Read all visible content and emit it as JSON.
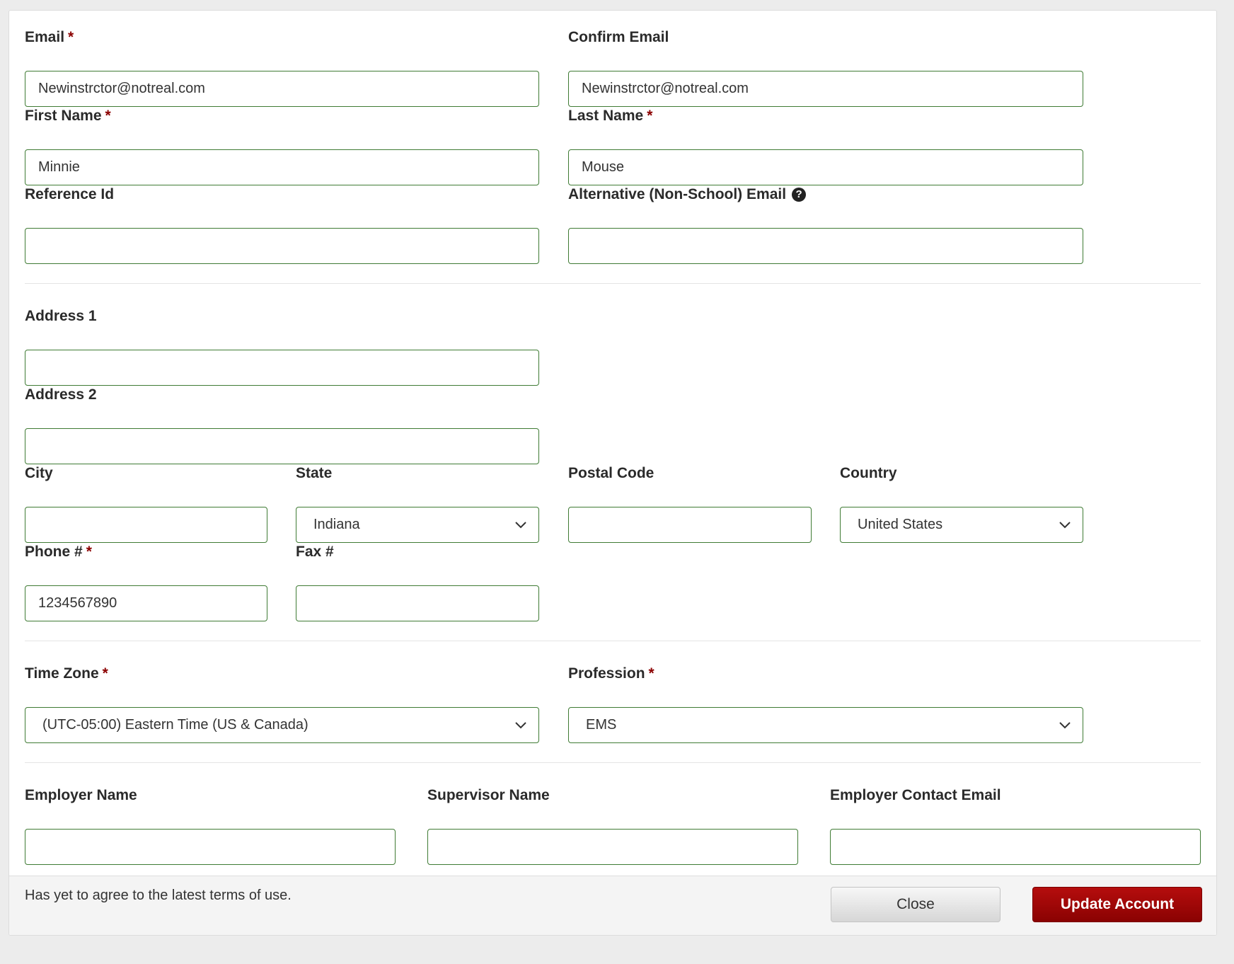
{
  "account_form": {
    "email": {
      "label": "Email",
      "value": "Newinstrctor@notreal.com",
      "required": true
    },
    "confirm_email": {
      "label": "Confirm Email",
      "value": "Newinstrctor@notreal.com"
    },
    "first_name": {
      "label": "First Name",
      "value": "Minnie",
      "required": true
    },
    "last_name": {
      "label": "Last Name",
      "value": "Mouse",
      "required": true
    },
    "reference_id": {
      "label": "Reference Id",
      "value": ""
    },
    "alt_email": {
      "label": "Alternative (Non-School) Email",
      "value": "",
      "help_icon": "question-circle-icon"
    },
    "address1": {
      "label": "Address 1",
      "value": ""
    },
    "address2": {
      "label": "Address 2",
      "value": ""
    },
    "city": {
      "label": "City",
      "value": ""
    },
    "state": {
      "label": "State",
      "selected": "Indiana"
    },
    "postal_code": {
      "label": "Postal Code",
      "value": ""
    },
    "country": {
      "label": "Country",
      "selected": "United States"
    },
    "phone": {
      "label": "Phone #",
      "value": "1234567890",
      "required": true
    },
    "fax": {
      "label": "Fax #",
      "value": ""
    },
    "time_zone": {
      "label": "Time Zone",
      "selected": "(UTC-05:00) Eastern Time (US & Canada)",
      "required": true
    },
    "profession": {
      "label": "Profession",
      "selected": "EMS",
      "required": true
    },
    "employer_name": {
      "label": "Employer Name",
      "value": ""
    },
    "supervisor_name": {
      "label": "Supervisor Name",
      "value": ""
    },
    "employer_contact_email": {
      "label": "Employer Contact Email",
      "value": ""
    },
    "required_marker": "*"
  },
  "footer": {
    "terms_notice": "Has yet to agree to the latest terms of use.",
    "close_label": "Close",
    "update_label": "Update Account"
  },
  "colors": {
    "input_border": "#3f7b34",
    "required_asterisk": "#8b0000",
    "primary_button": "#9e0606"
  }
}
